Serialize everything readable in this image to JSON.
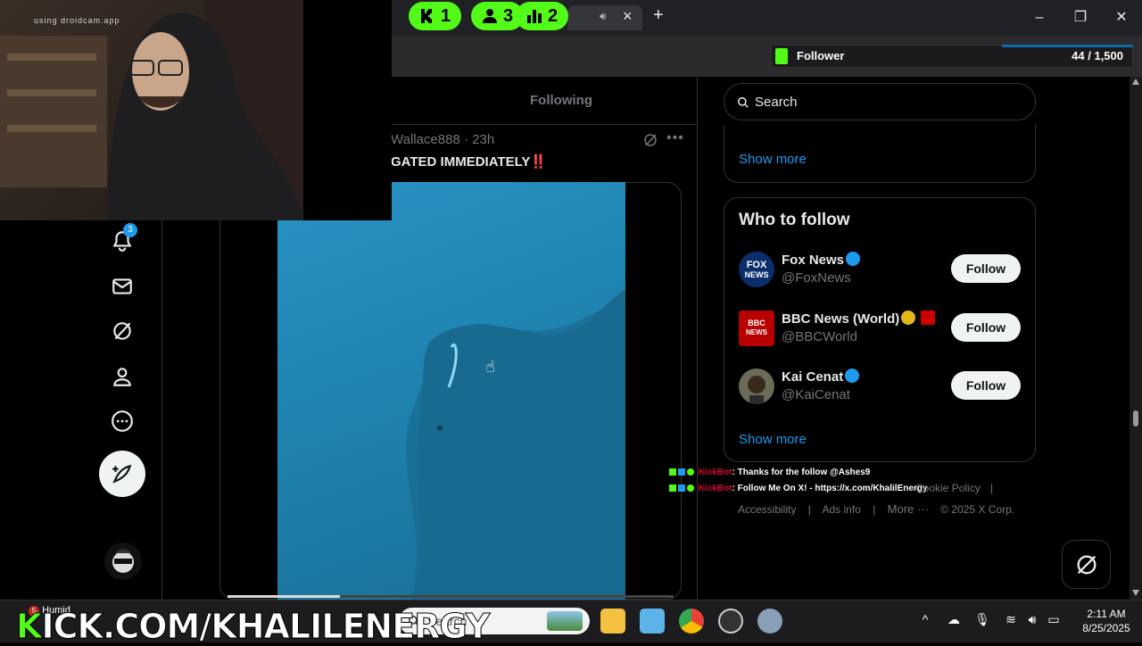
{
  "browser": {
    "new_tab": "+",
    "minimize": "–",
    "restore": "❐",
    "close": "✕",
    "tab_close": "×",
    "mute_icon": "speaker-icon"
  },
  "kick_pills": [
    {
      "icon": "kick-logo-icon",
      "value": "1"
    },
    {
      "icon": "person-icon",
      "value": "3"
    },
    {
      "icon": "bars-icon",
      "value": "2"
    }
  ],
  "follower_goal": {
    "label": "Follower",
    "count": "44 / 1,500"
  },
  "webcam": {
    "caption": "using droidcam.app"
  },
  "nav": {
    "notification_count": "3"
  },
  "feed": {
    "tab": "Following",
    "tweet_author": "Wallace888 · 23h",
    "tweet_text": "GATED IMMEDIATELY‼️"
  },
  "sidebar": {
    "search_placeholder": "Search",
    "show_more": "Show more",
    "who_to_follow_title": "Who to follow",
    "accounts": [
      {
        "name": "Fox News",
        "handle": "@FoxNews",
        "button": "Follow"
      },
      {
        "name": "BBC News (World)",
        "handle": "@BBCWorld",
        "button": "Follow"
      },
      {
        "name": "Kai Cenat",
        "handle": "@KaiCenat",
        "button": "Follow"
      }
    ],
    "show_more_2": "Show more"
  },
  "footer": {
    "cookie": "Cookie Policy",
    "sep": "|",
    "accessibility": "Accessibility",
    "ads_info": "Ads info",
    "more": "More ···",
    "copyright": "© 2025 X Corp."
  },
  "chat": [
    {
      "user": "KickBot",
      "message": ": Thanks for the follow @Ashes9"
    },
    {
      "user": "KickBot",
      "message": ": Follow Me On X! - https://x.com/KhalilEnergy"
    }
  ],
  "taskbar": {
    "search": "Search",
    "time": "2:11 AM",
    "date": "8/25/2025",
    "weather_label": "Humid",
    "weather_badge": "5"
  },
  "banner": {
    "prefix": "K",
    "text": "ICK.COM/KHALILENERGY"
  }
}
